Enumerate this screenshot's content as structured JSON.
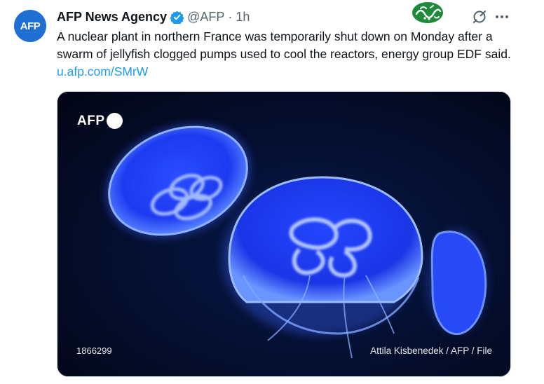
{
  "tweet": {
    "author": {
      "avatar_text": "AFP",
      "display_name": "AFP News Agency",
      "handle": "@AFP",
      "separator": "·",
      "timestamp": "1h",
      "verified": true
    },
    "text": "A nuclear plant in northern France was temporarily shut down on Monday after a swarm of jellyfish clogged pumps used to cool the reactors, energy group EDF said. ",
    "link_text": "u.afp.com/SMrW",
    "media": {
      "logo_text": "AFP",
      "photo_id": "1866299",
      "credit": "Attila Kisbenedek / AFP / File",
      "subject_icon": "jellyfish-photo"
    }
  },
  "icons": {
    "verified": "verified-badge-icon",
    "grok": "grok-icon",
    "more": "more-icon",
    "watermark": "watermark-logo"
  },
  "colors": {
    "link": "#1d9bf0",
    "verified": "#1d9bf0",
    "text": "#0f1419",
    "muted": "#536471",
    "avatar_bg": "#1e6fd1",
    "watermark_green": "#1f8a3a"
  }
}
